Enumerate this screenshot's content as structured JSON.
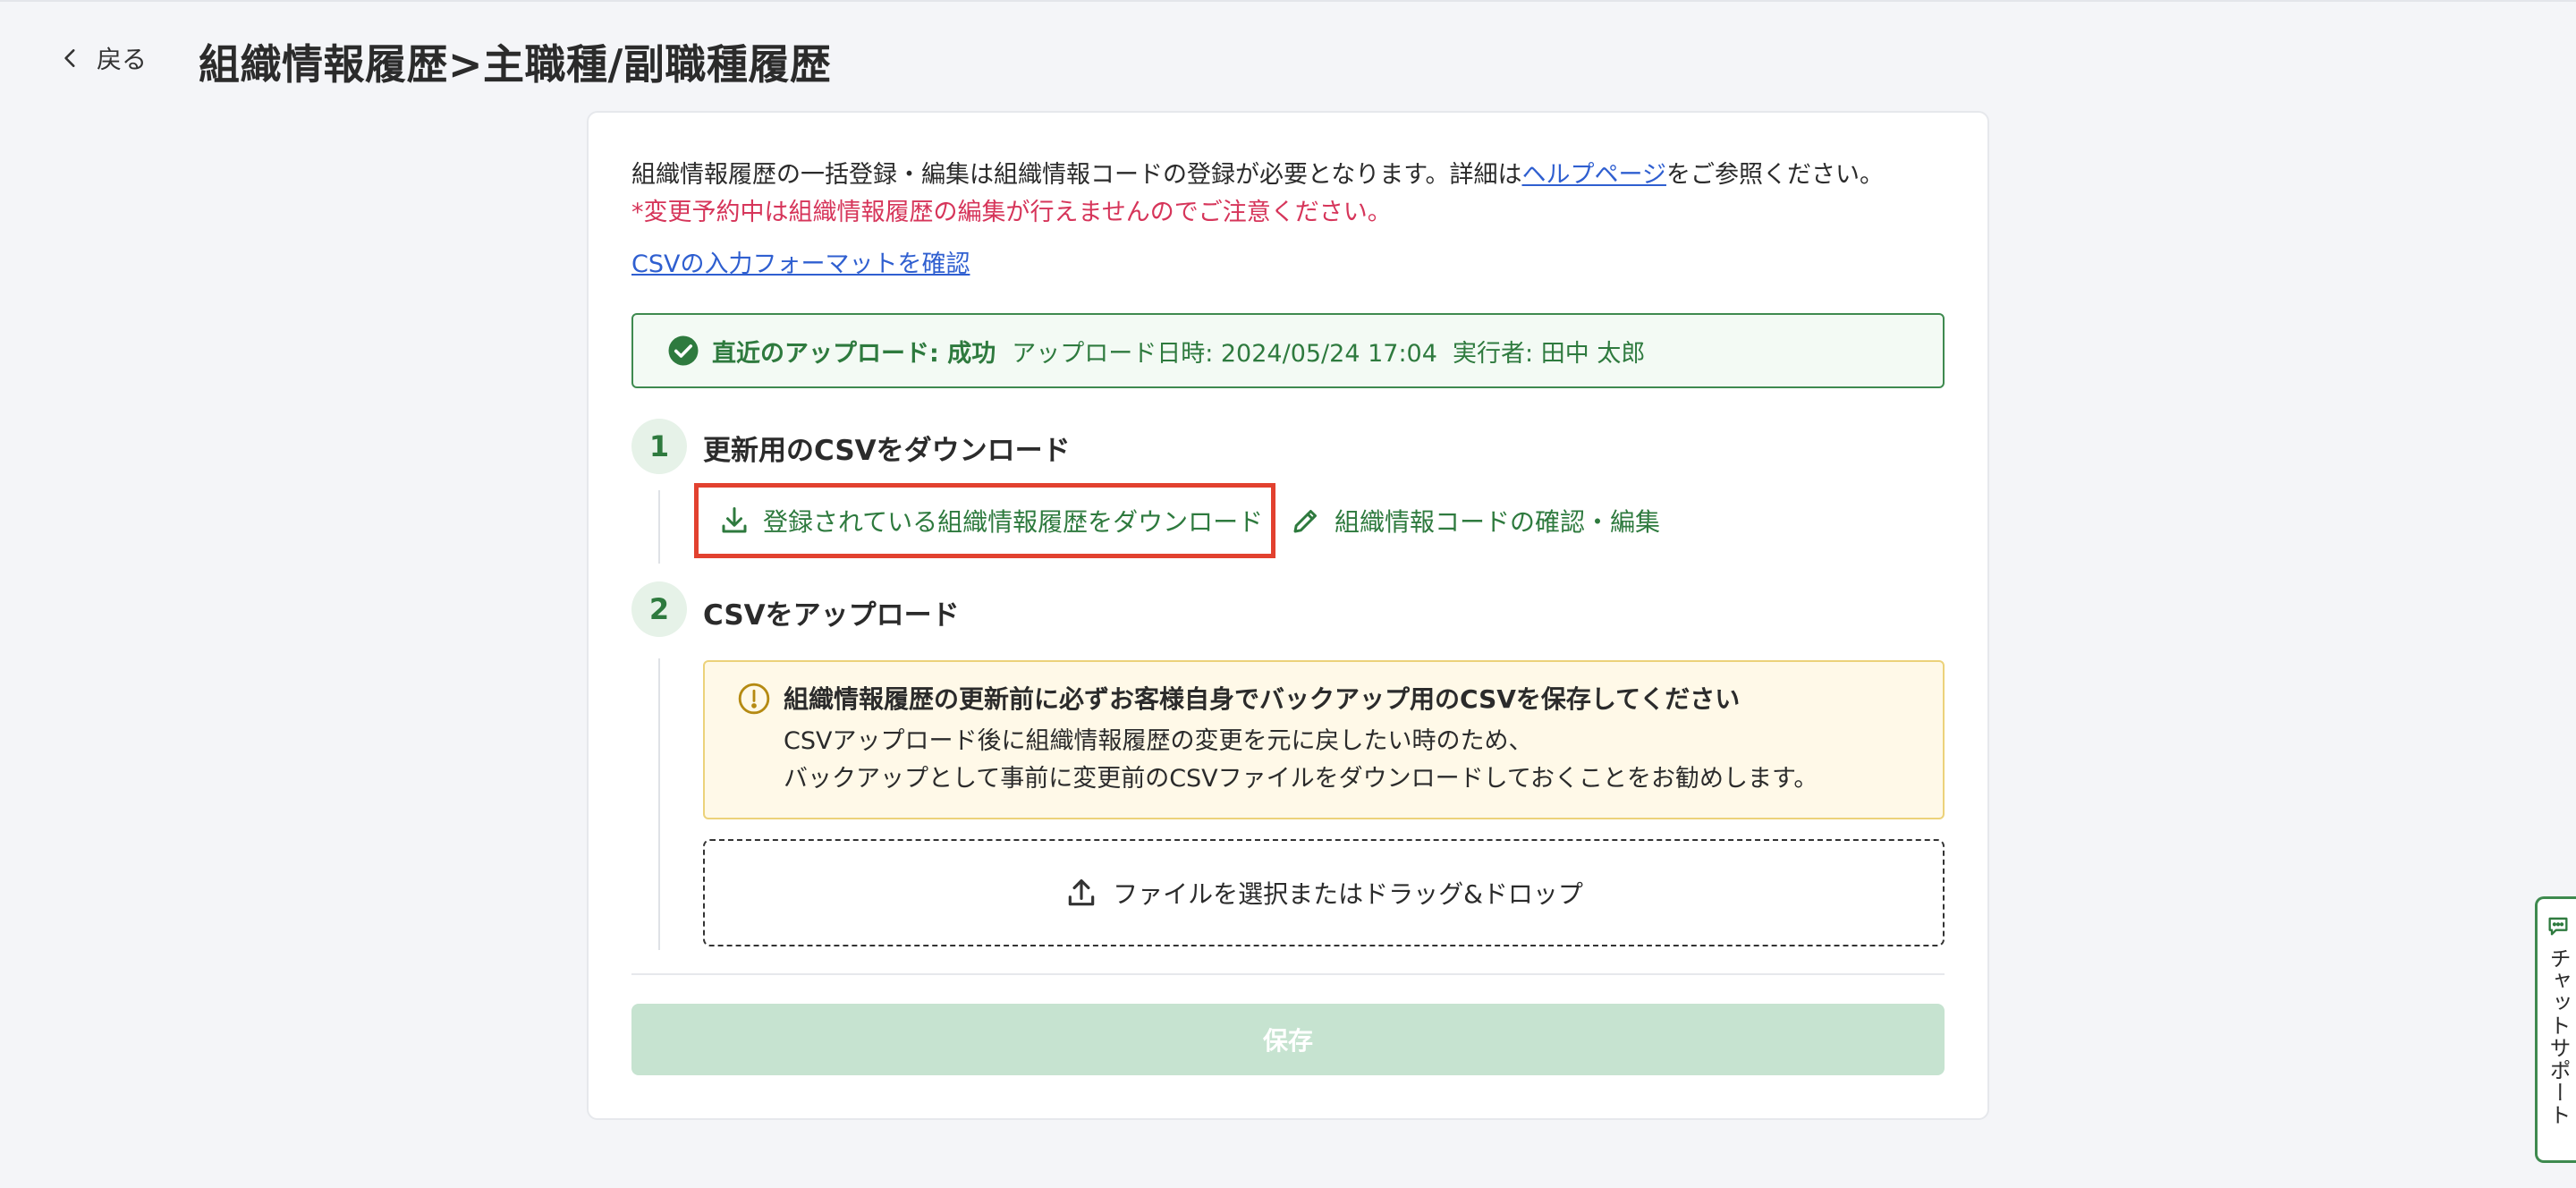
{
  "header": {
    "back_label": "戻る",
    "title": "組織情報履歴>主職種/副職種履歴"
  },
  "intro": {
    "text_before": "組織情報履歴の一括登録・編集は組織情報コードの登録が必要となります。詳細は",
    "help_link": "ヘルプページ",
    "text_after": "をご参照ください。",
    "warning": "*変更予約中は組織情報履歴の編集が行えませんのでご注意ください。",
    "format_link": "CSVの入力フォーマットを確認"
  },
  "status": {
    "lead": "直近のアップロード: 成功",
    "meta": "アップロード日時: 2024/05/24 17:04  実行者: 田中 太郎"
  },
  "step1": {
    "number": "1",
    "title": "更新用のCSVをダウンロード",
    "download_label": "登録されている組織情報履歴をダウンロード",
    "edit_label": "組織情報コードの確認・編集"
  },
  "step2": {
    "number": "2",
    "title": "CSVをアップロード",
    "notice_title": "組織情報履歴の更新前に必ずお客様自身でバックアップ用のCSVを保存してください",
    "notice_line1": "CSVアップロード後に組織情報履歴の変更を元に戻したい時のため、",
    "notice_line2": "バックアップとして事前に変更前のCSVファイルをダウンロードしておくことをお勧めします。",
    "dropzone_label": "ファイルを選択またはドラッグ&ドロップ"
  },
  "save_label": "保存",
  "chat_label": "チャットサポート",
  "colors": {
    "brand_green": "#2e7a3e",
    "link_blue": "#2f5fd0",
    "warning_red": "#d6355a",
    "highlight_red": "#e2412f",
    "notice_bg": "#fff9e8",
    "save_disabled": "#c6e3d0"
  },
  "icons": {
    "back": "chevron-left-icon",
    "status": "check-circle-icon",
    "download": "download-icon",
    "edit": "pencil-icon",
    "notice": "exclamation-circle-icon",
    "upload": "upload-icon",
    "chat": "chat-bubble-icon"
  }
}
